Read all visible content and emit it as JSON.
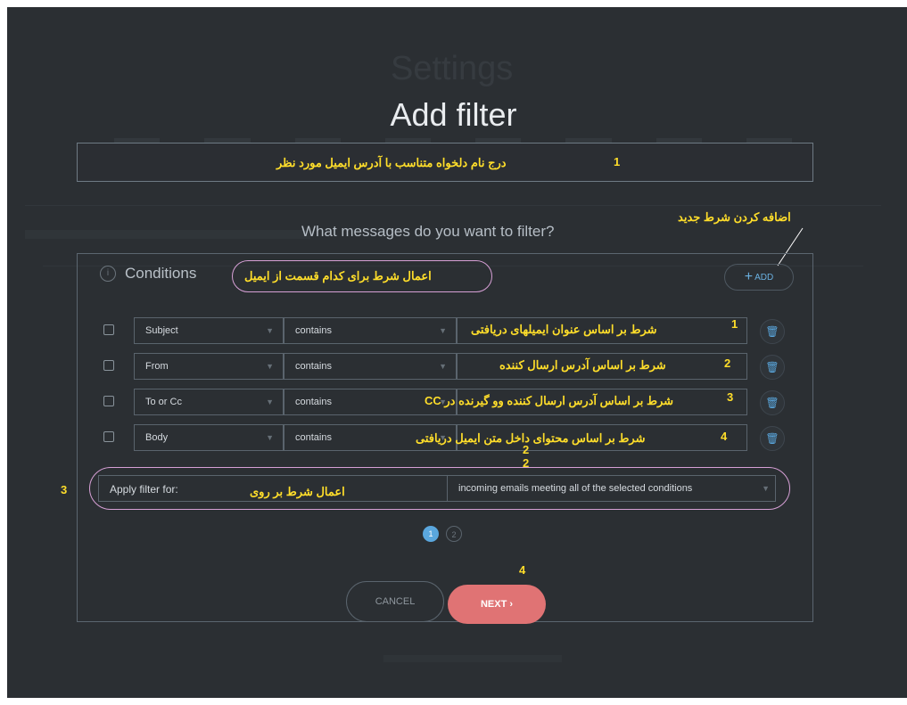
{
  "background": {
    "title": "Settings"
  },
  "modal": {
    "title": "Add filter",
    "question": "What messages do you want to filter?",
    "conditions_label": "Conditions",
    "add_button": "ADD",
    "conditions": [
      {
        "field": "Subject",
        "operator": "contains"
      },
      {
        "field": "From",
        "operator": "contains"
      },
      {
        "field": "To or Cc",
        "operator": "contains"
      },
      {
        "field": "Body",
        "operator": "contains"
      }
    ],
    "apply_label": "Apply filter for:",
    "apply_value": "incoming emails meeting all of the selected conditions",
    "pages": [
      "1",
      "2"
    ],
    "cancel_button": "CANCEL",
    "next_button": "NEXT ›"
  },
  "annotations": {
    "name_hint": "درج نام دلخواه متناسب با آدرس ایمیل مورد نظر",
    "add_hint": "اضافه کردن شرط جدید",
    "conditions_hint": "اعمال شرط برای کدام قسمت از ایمیل",
    "row1": "شرط بر اساس عنوان ایمیلهای دریافتی",
    "row2": "شرط بر اساس آدرس ارسال کننده",
    "row3": "شرط بر اساس آدرس ارسال کننده وو گیرنده در CC",
    "row4": "شرط بر اساس محتوای داخل متن ایمیل دریافتی",
    "apply_hint": "اعمال شرط بر روی",
    "num1": "1",
    "num_r1": "1",
    "num_r2": "2",
    "num_r3": "3",
    "num_r4": "4",
    "num_apply_top": "2",
    "num_apply_bottom": "2",
    "num_left": "3",
    "num_next": "4"
  },
  "colors": {
    "accent": "#5aa7de",
    "next_button": "#e07374",
    "annotation": "#ffde2a",
    "annotation_oval": "#d7a0d6",
    "background": "#2b2f33"
  }
}
